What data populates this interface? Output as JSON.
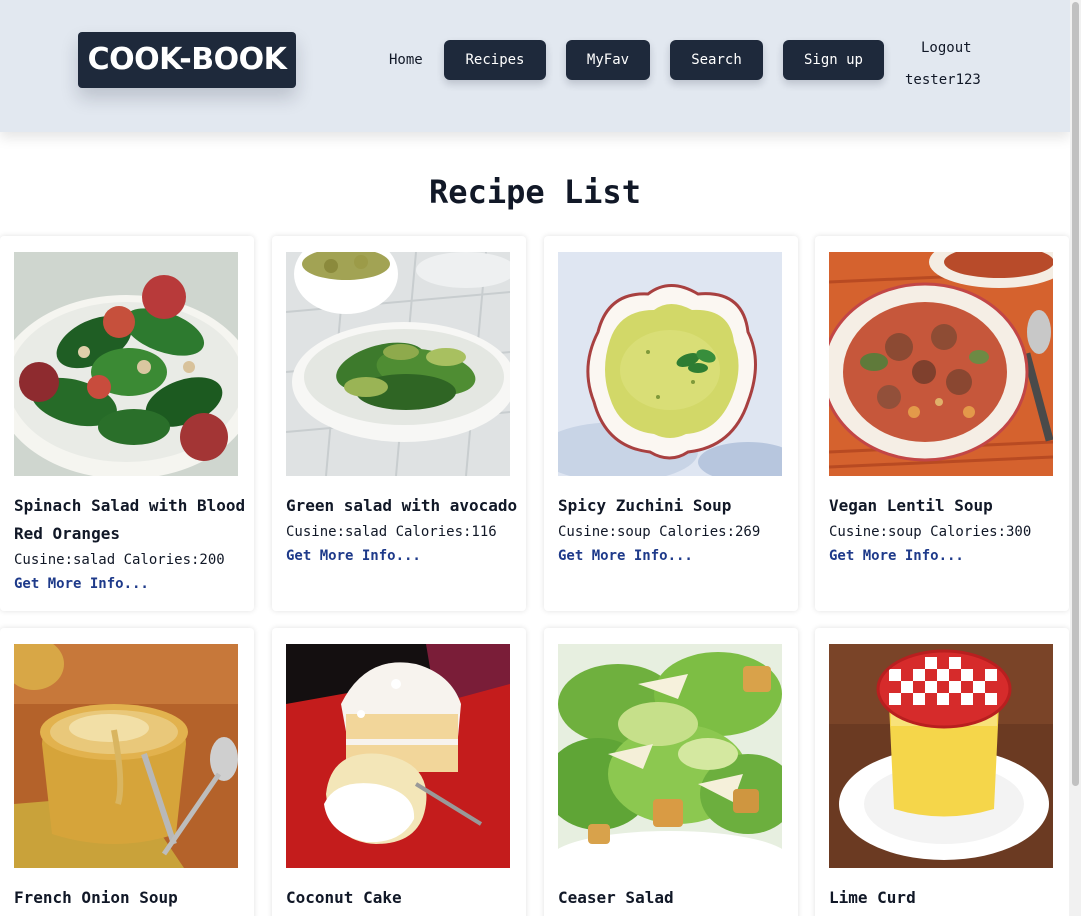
{
  "header": {
    "logo": "COOK-BOOK",
    "nav": {
      "home": "Home",
      "recipes": "Recipes",
      "myfav": "MyFav",
      "search": "Search",
      "signup": "Sign up",
      "logout": "Logout",
      "username": "tester123"
    }
  },
  "main": {
    "title": "Recipe List",
    "link_label": "Get More Info...",
    "recipes": [
      {
        "title": "Spinach Salad with Blood Red Oranges",
        "meta": "Cusine:salad Calories:200"
      },
      {
        "title": "Green salad with avocado",
        "meta": "Cusine:salad Calories:116"
      },
      {
        "title": "Spicy Zuchini Soup",
        "meta": "Cusine:soup Calories:269"
      },
      {
        "title": "Vegan Lentil Soup",
        "meta": "Cusine:soup Calories:300"
      },
      {
        "title": "French Onion Soup",
        "meta": ""
      },
      {
        "title": "Coconut Cake",
        "meta": ""
      },
      {
        "title": "Ceaser Salad",
        "meta": ""
      },
      {
        "title": "Lime Curd",
        "meta": ""
      }
    ]
  },
  "colors": {
    "header_bg": "#e2e8f0",
    "button_bg": "#1e293b",
    "link": "#1e3a8a"
  }
}
